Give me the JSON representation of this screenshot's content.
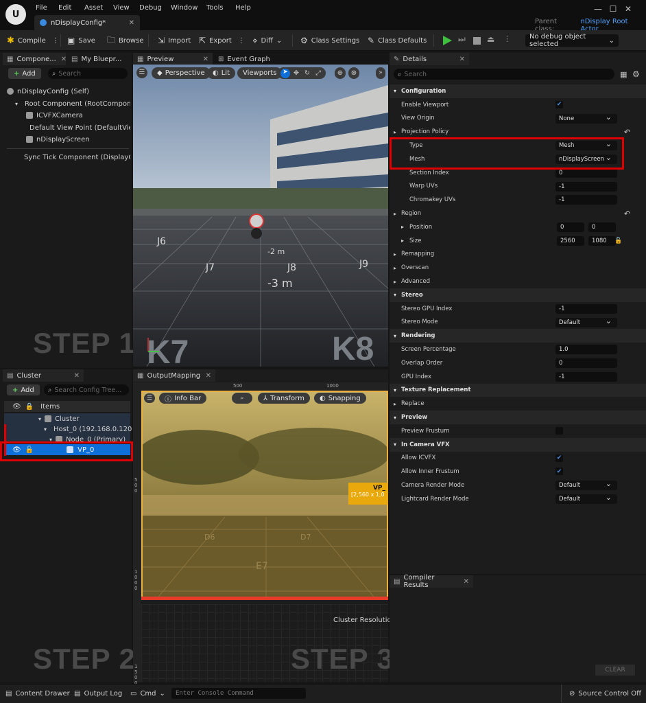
{
  "menu": [
    "File",
    "Edit",
    "Asset",
    "View",
    "Debug",
    "Window",
    "Tools",
    "Help"
  ],
  "doc_tab": "nDisplayConfig*",
  "parent_class_label": "Parent class:",
  "parent_class_value": "nDisplay Root Actor",
  "toolbar": {
    "compile": "Compile",
    "save": "Save",
    "browse": "Browse",
    "import": "Import",
    "export": "Export",
    "diff": "Diff",
    "class_settings": "Class Settings",
    "class_defaults": "Class Defaults",
    "debug_select": "No debug object selected"
  },
  "components": {
    "tab1": "Compone...",
    "tab2": "My Bluepr...",
    "add": "Add",
    "search_placeholder": "Search",
    "items": [
      "nDisplayConfig (Self)",
      "Root Component (RootCompone",
      "ICVFXCamera",
      "Default View Point (DefaultVie",
      "nDisplayScreen",
      "Sync Tick Component (DisplayCl"
    ]
  },
  "preview": {
    "tab1": "Preview",
    "tab2": "Event Graph",
    "perspective": "Perspective",
    "lit": "Lit",
    "viewports": "Viewports",
    "dist1": "-2 m",
    "dist2": "-3 m",
    "tiles": [
      "J6",
      "J7",
      "J8",
      "J9",
      "K7",
      "K8"
    ]
  },
  "steps": {
    "s1": "STEP 1",
    "s2": "STEP 2",
    "s3": "STEP 3"
  },
  "cluster": {
    "tab": "Cluster",
    "add": "Add",
    "search_placeholder": "Search Config Tree...",
    "items_header": "Items",
    "rows": [
      "Cluster",
      "Host_0 (192.168.0.120)",
      "Node_0 (Primary)",
      "VP_0"
    ]
  },
  "output": {
    "tab": "OutputMapping",
    "ruler1": "500",
    "ruler2": "1000",
    "ruler_left1": "500",
    "ruler_left2": "1000",
    "ruler_left3": "1500",
    "info_bar": "Info Bar",
    "transform": "Transform",
    "snapping": "Snapping",
    "vp_label": "VP_",
    "vp_size": "[2,560 x 1,0",
    "cluster_res": "Cluster Resolutio",
    "tiles": [
      "D6",
      "D7",
      "E7"
    ]
  },
  "details": {
    "tab": "Details",
    "search_placeholder": "Search",
    "rows": [
      {
        "label": "Configuration",
        "type": "cat"
      },
      {
        "label": "Enable Viewport",
        "type": "check",
        "value": "✔"
      },
      {
        "label": "View Origin",
        "type": "dd",
        "value": "None"
      },
      {
        "label": "Projection Policy",
        "type": "group"
      },
      {
        "label": "Type",
        "type": "dd",
        "value": "Mesh",
        "indent": 1
      },
      {
        "label": "Mesh",
        "type": "dd",
        "value": "nDisplayScreen",
        "indent": 1
      },
      {
        "label": "Section Index",
        "type": "num",
        "value": "0",
        "indent": 1
      },
      {
        "label": "Warp UVs",
        "type": "num",
        "value": "-1",
        "indent": 1
      },
      {
        "label": "Chromakey UVs",
        "type": "num",
        "value": "-1",
        "indent": 1
      },
      {
        "label": "Region",
        "type": "group"
      },
      {
        "label": "Position",
        "type": "pair",
        "v1": "0",
        "v2": "0",
        "indent": 1
      },
      {
        "label": "Size",
        "type": "pair",
        "v1": "2560",
        "v2": "1080",
        "indent": 1
      },
      {
        "label": "Remapping",
        "type": "group"
      },
      {
        "label": "Overscan",
        "type": "group"
      },
      {
        "label": "Advanced",
        "type": "group"
      },
      {
        "label": "Stereo",
        "type": "cat"
      },
      {
        "label": "Stereo GPU Index",
        "type": "num",
        "value": "-1"
      },
      {
        "label": "Stereo Mode",
        "type": "dd",
        "value": "Default"
      },
      {
        "label": "Rendering",
        "type": "cat"
      },
      {
        "label": "Screen Percentage",
        "type": "num",
        "value": "1.0"
      },
      {
        "label": "Overlap Order",
        "type": "num",
        "value": "0"
      },
      {
        "label": "GPU Index",
        "type": "num",
        "value": "-1"
      },
      {
        "label": "Texture Replacement",
        "type": "cat"
      },
      {
        "label": "Replace",
        "type": "group"
      },
      {
        "label": "Preview",
        "type": "cat"
      },
      {
        "label": "Preview Frustum",
        "type": "check",
        "value": ""
      },
      {
        "label": "In Camera VFX",
        "type": "cat"
      },
      {
        "label": "Allow ICVFX",
        "type": "check",
        "value": "✔"
      },
      {
        "label": "Allow Inner Frustum",
        "type": "check",
        "value": "✔"
      },
      {
        "label": "Camera Render Mode",
        "type": "dd",
        "value": "Default"
      },
      {
        "label": "Lightcard Render Mode",
        "type": "dd",
        "value": "Default"
      }
    ]
  },
  "compiler": {
    "tab": "Compiler Results",
    "clear": "CLEAR"
  },
  "status": {
    "content_drawer": "Content Drawer",
    "output_log": "Output Log",
    "cmd": "Cmd",
    "console_placeholder": "Enter Console Command",
    "source_control": "Source Control Off"
  },
  "colors": {
    "accent": "#0e6fd8",
    "highlight": "#e00000",
    "play": "#3fbf3f"
  }
}
